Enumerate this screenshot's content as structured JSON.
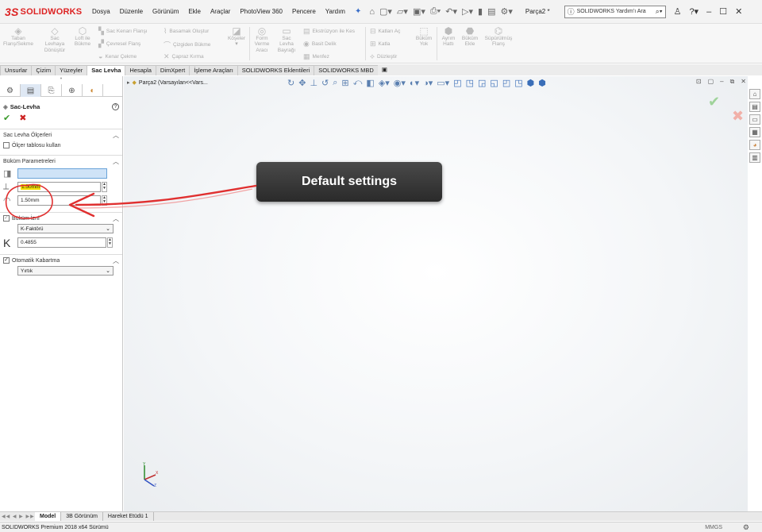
{
  "app": {
    "brand_prefix": "3S",
    "brand": "SOLIDWORKS"
  },
  "menu": [
    "Dosya",
    "Düzenle",
    "Görünüm",
    "Ekle",
    "Araçlar",
    "PhotoView 360",
    "Pencere",
    "Yardım"
  ],
  "document": {
    "name": "Parça2 *"
  },
  "search": {
    "placeholder": "SOLIDWORKS Yardım'ı Ara"
  },
  "ribbon": {
    "base_flange": "Taban\nFlanş/Sekme",
    "convert_to_sheet": "Sac\nLevhaya\nDönüştür",
    "lofted_bend": "Loft ile\nBükme",
    "edge_flange": "Sac Kenarı Flanşı",
    "miter_flange": "Çevresel Flanş",
    "hem": "Kenar Çekme",
    "jog": "Basamak Oluştur",
    "sketched_bend": "Çizgiden Bükme",
    "cross_break": "Çapraz Kırma",
    "corners": "Köşeler",
    "forming_tool": "Form\nVerme\nAracı",
    "tab_slot": "Sac\nLevha\nBayrağı",
    "extruded_cut": "Ekstrüzyon ile Kes",
    "simple_hole": "Basit Delik",
    "vent": "Menfez",
    "unfold": "Katları Aç",
    "fold": "Katla",
    "flatten": "Düzleştir",
    "no_bends": "Büküm\nYok",
    "rip": "Ayrım\nHattı",
    "insert_bends": "Büküm\nEkle",
    "swept_flange": "Süpürülmüş\nFlanş"
  },
  "tabs": [
    "Unsurlar",
    "Çizim",
    "Yüzeyler",
    "Sac Levha",
    "Hesapla",
    "DimXpert",
    "İşleme Araçları",
    "SOLIDWORKS Eklentileri",
    "SOLIDWORKS MBD"
  ],
  "active_tab": "Sac Levha",
  "property_manager": {
    "title": "Sac-Levha",
    "gauge_section": {
      "title": "Sac Levha Ölçerleri",
      "use_gauge_label": "Ölçer tablosu kullan",
      "use_gauge_checked": false
    },
    "bend_section": {
      "title": "Büküm Parametreleri",
      "fixed_face_value": "",
      "thickness_value": "1.50mm",
      "radius_value": "1.50mm"
    },
    "allowance_section": {
      "title": "Büküm İzni",
      "type_value": "K-Faktörü",
      "k_label": "K",
      "k_value": "0.4855",
      "checked": true
    },
    "relief_section": {
      "title": "Otomatik Kabartma",
      "type_value": "Yırtık",
      "checked": true
    }
  },
  "graphics": {
    "tree_node": "Parça2  (Varsayılan<<Vars...",
    "callout": "Default settings"
  },
  "bottom_tabs": [
    "Model",
    "3B Görünüm",
    "Hareket Etüdü 1"
  ],
  "active_bottom_tab": "Model",
  "status": {
    "text": "SOLIDWORKS Premium 2018 x64 Sürümü",
    "units": "MMGS"
  },
  "colors": {
    "brand_red": "#d22222",
    "accept_green": "#3a9b2a",
    "cancel_red": "#cc2222",
    "annotation_red": "#e03030"
  }
}
